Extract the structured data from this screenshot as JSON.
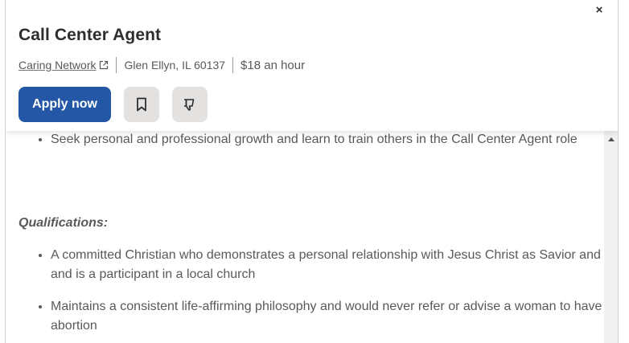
{
  "header": {
    "close_label": "×",
    "title": "Call Center Agent",
    "company": "Caring Network",
    "location": "Glen Ellyn, IL 60137",
    "salary": "$18 an hour"
  },
  "actions": {
    "apply_label": "Apply now",
    "save_icon": "bookmark-icon",
    "dislike_icon": "thumbs-down-icon"
  },
  "description": {
    "list_before": [
      "Seek personal and professional growth and learn to train others in the Call Center Agent role"
    ],
    "qualifications_heading": "Qualifications:",
    "qualifications": [
      "A committed Christian who demonstrates a personal relationship with Jesus Christ as Savior and Lord and is a participant in a local church",
      "Maintains a consistent life-affirming philosophy and would never refer or advise a woman to have an abortion"
    ]
  },
  "colors": {
    "primary": "#2557a7",
    "text": "#2d2d2d",
    "muted": "#595959",
    "button_bg": "#e4e2e0"
  }
}
